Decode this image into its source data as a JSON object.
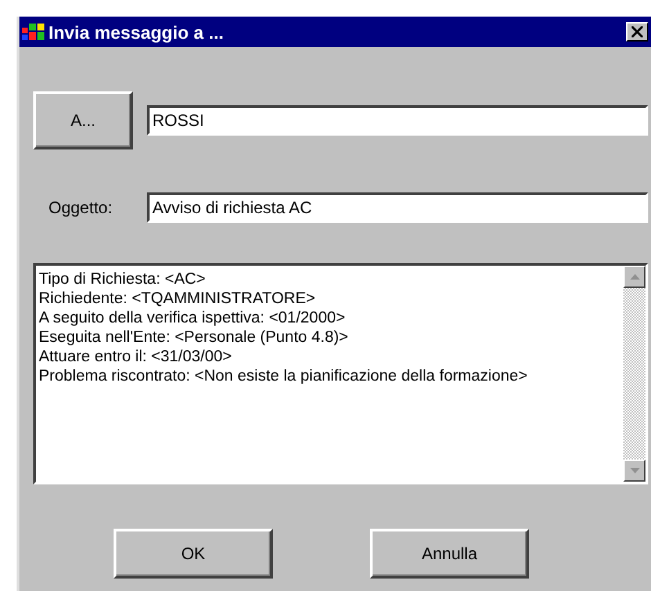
{
  "window": {
    "title": "Invia messaggio a ..."
  },
  "recipient": {
    "button": "A...",
    "value": "ROSSI"
  },
  "subject": {
    "label": "Oggetto:",
    "value": "Avviso di richiesta AC"
  },
  "message": {
    "lines": [
      "Tipo di Richiesta: <AC>",
      "Richiedente: <TQAMMINISTRATORE>",
      "A seguito della verifica ispettiva: <01/2000>",
      "Eseguita nell'Ente: <Personale (Punto 4.8)>",
      "Attuare entro il: <31/03/00>",
      "Problema riscontrato: <Non esiste la pianificazione della formazione>"
    ]
  },
  "buttons": [
    "OK",
    "Annulla"
  ]
}
